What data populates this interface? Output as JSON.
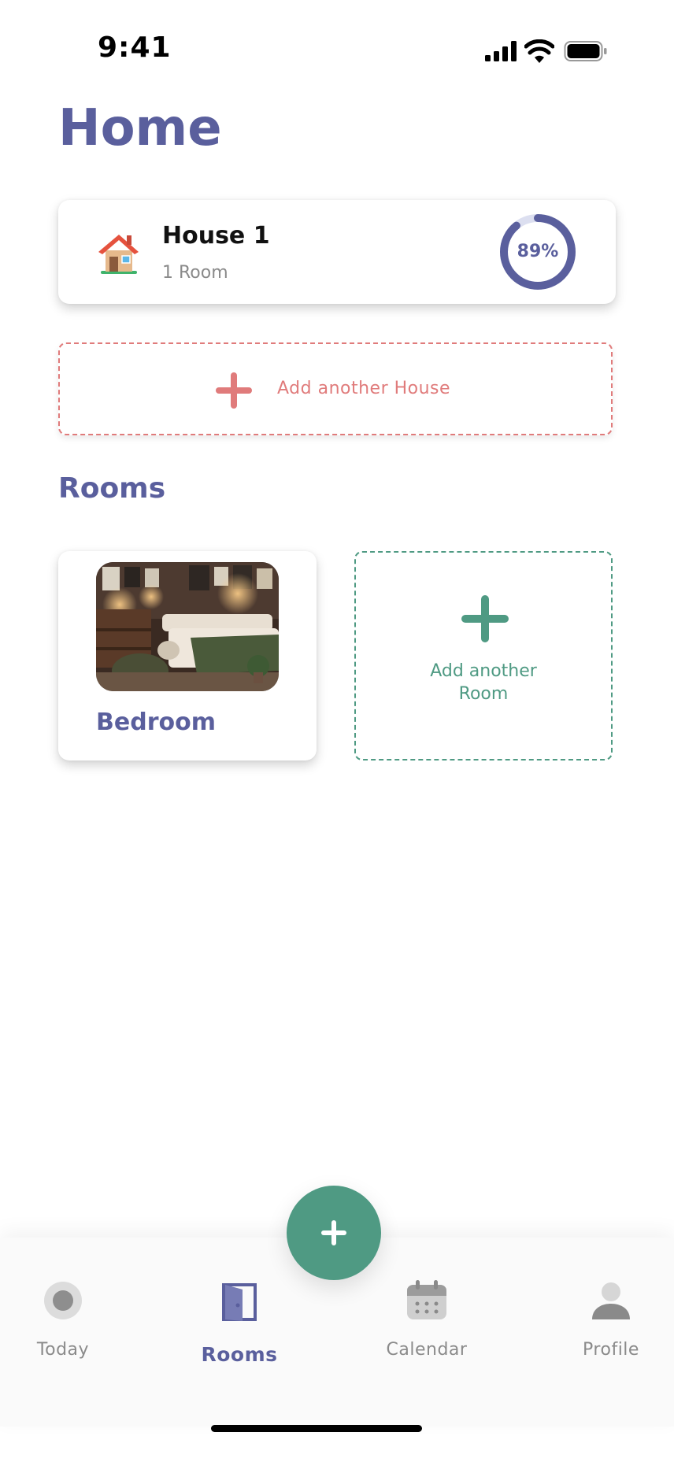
{
  "status_bar": {
    "time": "9:41"
  },
  "page": {
    "title": "Home"
  },
  "house": {
    "name": "House 1",
    "rooms_count": "1 Room",
    "progress_label": "89%",
    "progress_value": 0.89
  },
  "add_house": {
    "label": "Add another House"
  },
  "rooms_section": {
    "title": "Rooms"
  },
  "rooms": [
    {
      "name": "Bedroom"
    }
  ],
  "add_room": {
    "label": "Add another\nRoom"
  },
  "tab_bar": {
    "items": [
      {
        "label": "Today",
        "icon": "today-icon"
      },
      {
        "label": "Rooms",
        "icon": "door-icon",
        "active": true
      },
      {
        "label": "Calendar",
        "icon": "calendar-icon"
      },
      {
        "label": "Profile",
        "icon": "profile-icon"
      }
    ],
    "fab_icon": "plus-icon"
  },
  "colors": {
    "primary": "#5a5f9d",
    "accent_green": "#4f9a83",
    "accent_red": "#e07b7b"
  }
}
